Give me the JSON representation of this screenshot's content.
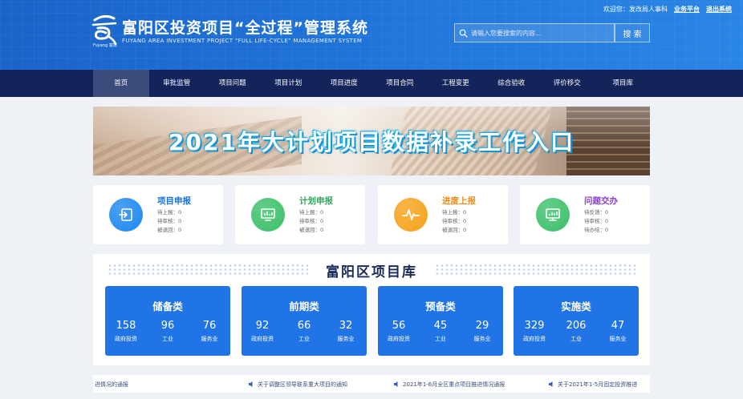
{
  "header": {
    "title": "富阳区投资项目“全过程”管理系统",
    "subtitle": "FUYANG AREA INVESTMENT PROJECT “FULL LIFE-CYCLE” MANAGEMENT SYSTEM",
    "logo_text": "Fuyang 富阳",
    "welcome": "欢迎您：发改局人事科",
    "link_business": "业务平台",
    "link_logout": "退出系统",
    "search_placeholder": "请输入您要搜索的内容...",
    "search_button": "搜 索"
  },
  "nav": {
    "items": [
      {
        "label": "首页",
        "active": true
      },
      {
        "label": "审批监管"
      },
      {
        "label": "项目问题"
      },
      {
        "label": "项目计划"
      },
      {
        "label": "项目进度"
      },
      {
        "label": "项目合同"
      },
      {
        "label": "工程变更"
      },
      {
        "label": "综合验收"
      },
      {
        "label": "评价移交"
      },
      {
        "label": "项目库"
      }
    ]
  },
  "banner": {
    "text": "2021年大计划项目数据补录工作入口"
  },
  "quick_cards": [
    {
      "title": "项目申报",
      "color": "#1e88f0",
      "title_color": "#1e6fd6",
      "icon": "import-icon",
      "lines": [
        "待上报：0",
        "待审核：0",
        "被退回：0"
      ]
    },
    {
      "title": "计划申报",
      "color": "#3cc06a",
      "title_color": "#2faa5a",
      "icon": "chart-monitor-icon",
      "lines": [
        "待上报：0",
        "待审核：0",
        "被退回：0"
      ]
    },
    {
      "title": "进度上报",
      "color": "#f6a21a",
      "title_color": "#ef8b12",
      "icon": "pulse-icon",
      "lines": [
        "待上报：0",
        "待审核：0",
        "被退回：0"
      ]
    },
    {
      "title": "问题交办",
      "color": "#3cc06a",
      "title_color": "#8a3fd4",
      "icon": "monitor-icon",
      "lines": [
        "待反馈：0",
        "待审核：0",
        "待办结：0"
      ]
    }
  ],
  "library": {
    "title": "富阳区项目库",
    "cards": [
      {
        "title": "储备类",
        "stats": [
          {
            "num": "158",
            "label": "政府投资"
          },
          {
            "num": "96",
            "label": "工业"
          },
          {
            "num": "76",
            "label": "服务业"
          }
        ]
      },
      {
        "title": "前期类",
        "stats": [
          {
            "num": "92",
            "label": "政府投资"
          },
          {
            "num": "66",
            "label": "工业"
          },
          {
            "num": "32",
            "label": "服务业"
          }
        ]
      },
      {
        "title": "预备类",
        "stats": [
          {
            "num": "56",
            "label": "政府投资"
          },
          {
            "num": "45",
            "label": "工业"
          },
          {
            "num": "29",
            "label": "服务业"
          }
        ]
      },
      {
        "title": "实施类",
        "stats": [
          {
            "num": "329",
            "label": "政府投资"
          },
          {
            "num": "206",
            "label": "工业"
          },
          {
            "num": "47",
            "label": "服务业"
          }
        ]
      }
    ]
  },
  "notices": [
    "进情况的通报",
    "关于调整区领导联系重大项目的通知",
    "2021年1-6月全区重点项目推进情况通报",
    "关于2021年1-5月固定投资推进"
  ]
}
